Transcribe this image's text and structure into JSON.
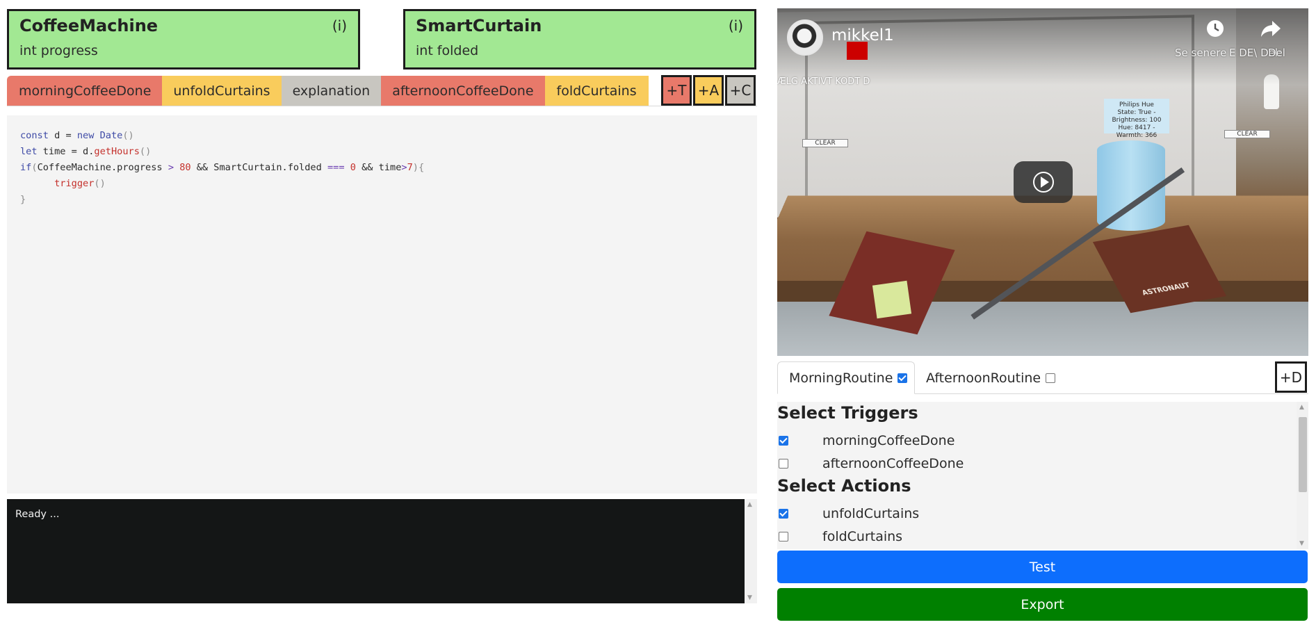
{
  "devices": [
    {
      "name": "CoffeeMachine",
      "info": "(i)",
      "field": "int progress"
    },
    {
      "name": "SmartCurtain",
      "info": "(i)",
      "field": "int folded"
    }
  ],
  "code_tabs": [
    {
      "label": "morningCoffeeDone",
      "color": "#e8796a"
    },
    {
      "label": "unfoldCurtains",
      "color": "#f9cc5c"
    },
    {
      "label": "explanation",
      "color": "#c8c6c0"
    },
    {
      "label": "afternoonCoffeeDone",
      "color": "#e8796a"
    },
    {
      "label": "foldCurtains",
      "color": "#f9cc5c"
    }
  ],
  "add_buttons": [
    {
      "label": "+T",
      "color": "#e8796a"
    },
    {
      "label": "+A",
      "color": "#f9cc5c"
    },
    {
      "label": "+C",
      "color": "#c8c6c0"
    }
  ],
  "editor": {
    "lines": [
      "const d = new Date()",
      "let time = d.getHours()",
      "if(CoffeeMachine.progress > 80 && SmartCurtain.folded === 0 && time>7){",
      "      trigger()",
      "}"
    ]
  },
  "console": {
    "text": "Ready ..."
  },
  "video": {
    "channel": "mikkel1",
    "watch_later": "Se senere",
    "share": "Del",
    "overlay_right": "E DE\\ Del:",
    "overlay_text": "ÆLG AKTIVT KODT D",
    "hue_label_title": "Philips Hue",
    "hue_label_line1": "State: True - Brightness: 100",
    "hue_label_line2": "Hue: 8417 - Warmth: 366",
    "clear_left": "CLEAR",
    "clear_right": "CLEAR",
    "poster_text": "ASTRONAUT"
  },
  "routines": [
    {
      "label": "MorningRoutine",
      "checked": true,
      "active": true
    },
    {
      "label": "AfternoonRoutine",
      "checked": false,
      "active": false
    }
  ],
  "add_routine_label": "+D",
  "select": {
    "triggers_heading": "Select Triggers",
    "triggers": [
      {
        "label": "morningCoffeeDone",
        "checked": true
      },
      {
        "label": "afternoonCoffeeDone",
        "checked": false
      }
    ],
    "actions_heading": "Select Actions",
    "actions": [
      {
        "label": "unfoldCurtains",
        "checked": true
      },
      {
        "label": "foldCurtains",
        "checked": false
      }
    ]
  },
  "buttons": {
    "test_label": "Test",
    "export_label": "Export",
    "test_color": "#0d6efd",
    "export_color": "#008000"
  }
}
